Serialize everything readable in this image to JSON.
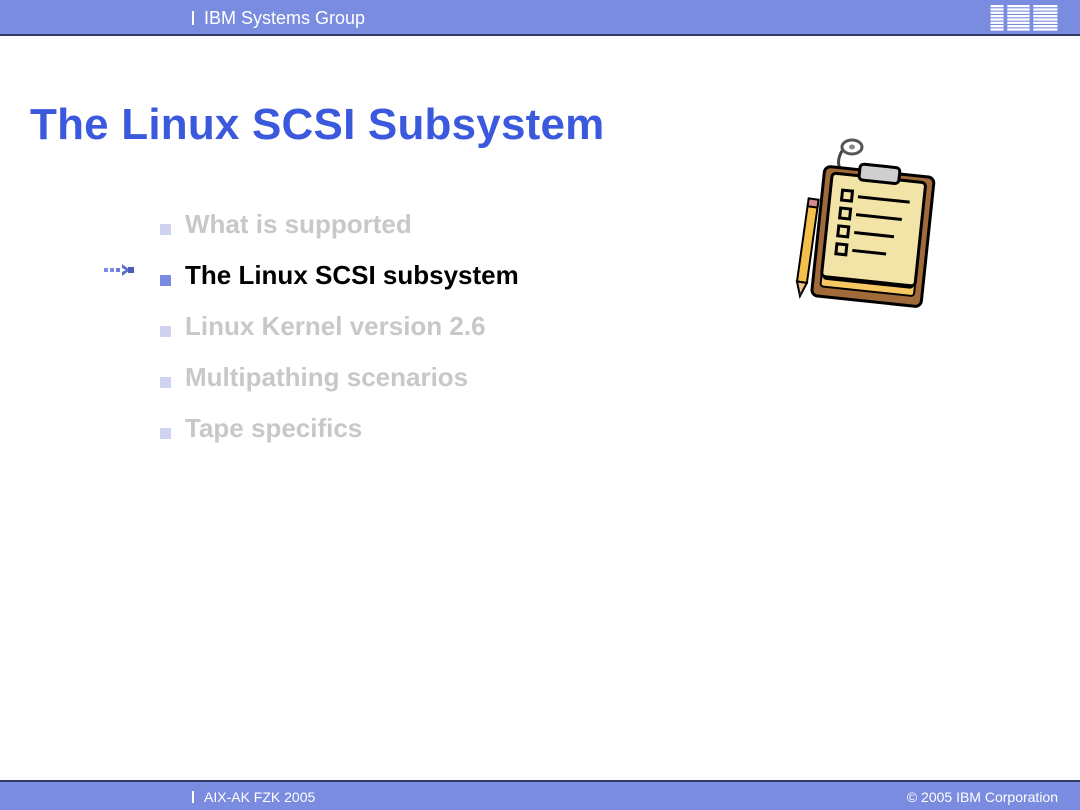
{
  "header": {
    "group": "IBM Systems Group",
    "logo_alt": "IBM"
  },
  "title": "The Linux SCSI Subsystem",
  "agenda": {
    "items": [
      {
        "label": "What is supported",
        "active": false
      },
      {
        "label": "The Linux SCSI subsystem",
        "active": true
      },
      {
        "label": "Linux Kernel version 2.6",
        "active": false
      },
      {
        "label": "Multipathing scenarios",
        "active": false
      },
      {
        "label": "Tape specifics",
        "active": false
      }
    ]
  },
  "footer": {
    "left": "AIX-AK FZK 2005",
    "right": "© 2005 IBM Corporation"
  },
  "colors": {
    "brand_blue": "#3b59dc",
    "bar_blue": "#7a8ce0",
    "bar_border": "#323c6b",
    "dim_text": "#c8c8c8"
  }
}
